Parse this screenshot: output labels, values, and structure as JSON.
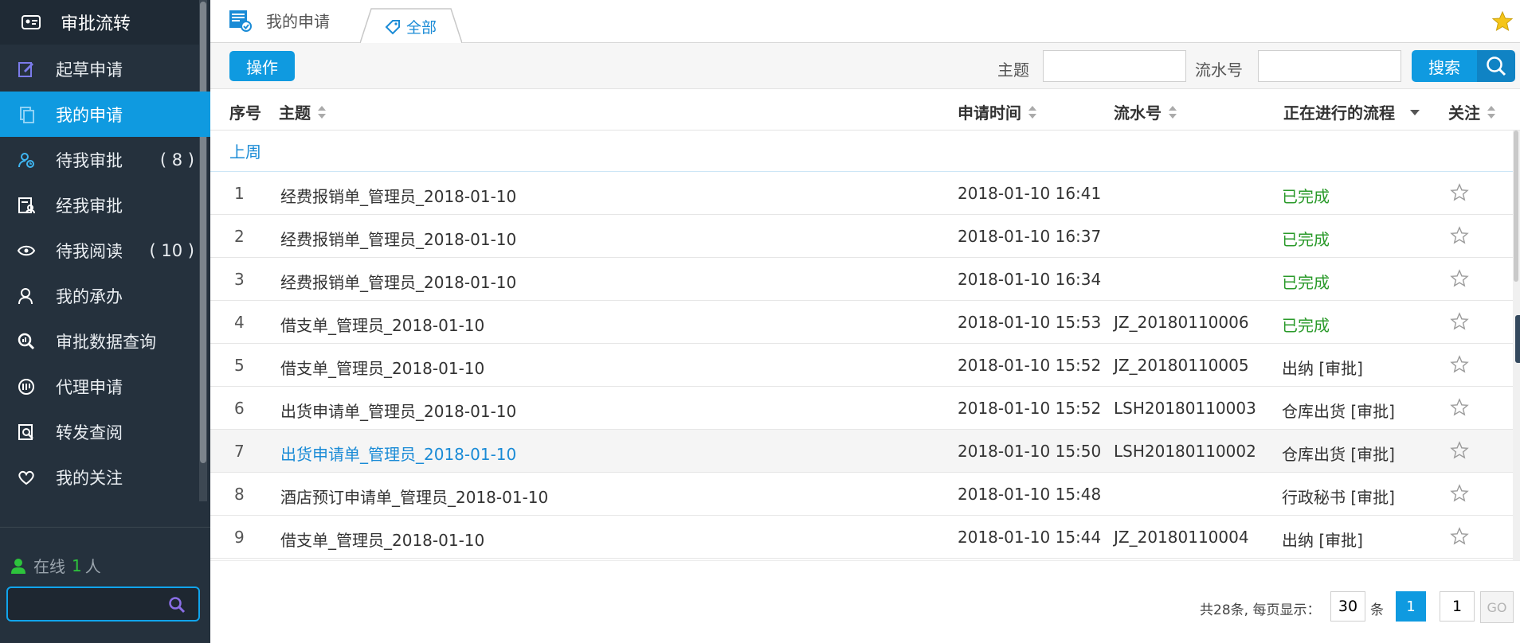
{
  "sidebar": {
    "title": "审批流转",
    "items": [
      {
        "label": "起草申请",
        "icon": "edit-icon",
        "active": false
      },
      {
        "label": "我的申请",
        "icon": "copy-icon",
        "active": true
      },
      {
        "label": "待我审批",
        "icon": "user-clock-icon",
        "count": "( 8 )",
        "active": false
      },
      {
        "label": "经我审批",
        "icon": "document-user-icon",
        "active": false
      },
      {
        "label": "待我阅读",
        "icon": "eye-icon",
        "count": "( 10 )",
        "active": false
      },
      {
        "label": "我的承办",
        "icon": "user-icon",
        "active": false
      },
      {
        "label": "审批数据查询",
        "icon": "search-data-icon",
        "active": false
      },
      {
        "label": "代理申请",
        "icon": "proxy-icon",
        "active": false
      },
      {
        "label": "转发查阅",
        "icon": "forward-search-icon",
        "active": false
      },
      {
        "label": "我的关注",
        "icon": "heart-icon",
        "active": false
      }
    ],
    "online_label": "在线",
    "online_count": "1",
    "online_unit": "人",
    "search_placeholder": ""
  },
  "tabs": {
    "page_tab": "我的申请",
    "filter_tab": "全部"
  },
  "toolbar": {
    "operate_label": "操作",
    "subject_label": "主题",
    "subject_value": "",
    "serial_label": "流水号",
    "serial_value": "",
    "search_label": "搜索"
  },
  "table": {
    "columns": {
      "index": "序号",
      "subject": "主题",
      "time": "申请时间",
      "serial": "流水号",
      "flow": "正在进行的流程",
      "follow": "关注"
    },
    "group_label": "上周",
    "rows": [
      {
        "index": "1",
        "subject": "经费报销单_管理员_2018-01-10",
        "time": "2018-01-10 16:41",
        "serial": "",
        "flow": "已完成",
        "done": true
      },
      {
        "index": "2",
        "subject": "经费报销单_管理员_2018-01-10",
        "time": "2018-01-10 16:37",
        "serial": "",
        "flow": "已完成",
        "done": true
      },
      {
        "index": "3",
        "subject": "经费报销单_管理员_2018-01-10",
        "time": "2018-01-10 16:34",
        "serial": "",
        "flow": "已完成",
        "done": true
      },
      {
        "index": "4",
        "subject": "借支单_管理员_2018-01-10",
        "time": "2018-01-10 15:53",
        "serial": "JZ_20180110006",
        "flow": "已完成",
        "done": true
      },
      {
        "index": "5",
        "subject": "借支单_管理员_2018-01-10",
        "time": "2018-01-10 15:52",
        "serial": "JZ_20180110005",
        "flow": "出纳 [审批]",
        "done": false
      },
      {
        "index": "6",
        "subject": "出货申请单_管理员_2018-01-10",
        "time": "2018-01-10 15:52",
        "serial": "LSH20180110003",
        "flow": "仓库出货 [审批]",
        "done": false
      },
      {
        "index": "7",
        "subject": "出货申请单_管理员_2018-01-10",
        "time": "2018-01-10 15:50",
        "serial": "LSH20180110002",
        "flow": "仓库出货 [审批]",
        "done": false,
        "highlight": true
      },
      {
        "index": "8",
        "subject": "酒店预订申请单_管理员_2018-01-10",
        "time": "2018-01-10 15:48",
        "serial": "",
        "flow": "行政秘书 [审批]",
        "done": false
      },
      {
        "index": "9",
        "subject": "借支单_管理员_2018-01-10",
        "time": "2018-01-10 15:44",
        "serial": "JZ_20180110004",
        "flow": "出纳 [审批]",
        "done": false
      }
    ]
  },
  "pagination": {
    "info": "共28条, 每页显示：",
    "page_size": "30",
    "unit": "条",
    "current_page": "1",
    "goto_value": "1",
    "go_label": "GO"
  },
  "colors": {
    "accent": "#0f9ae0",
    "sidebar_bg": "#25313d",
    "done_green": "#2a9a2a",
    "link_blue": "#1a8bd6"
  }
}
